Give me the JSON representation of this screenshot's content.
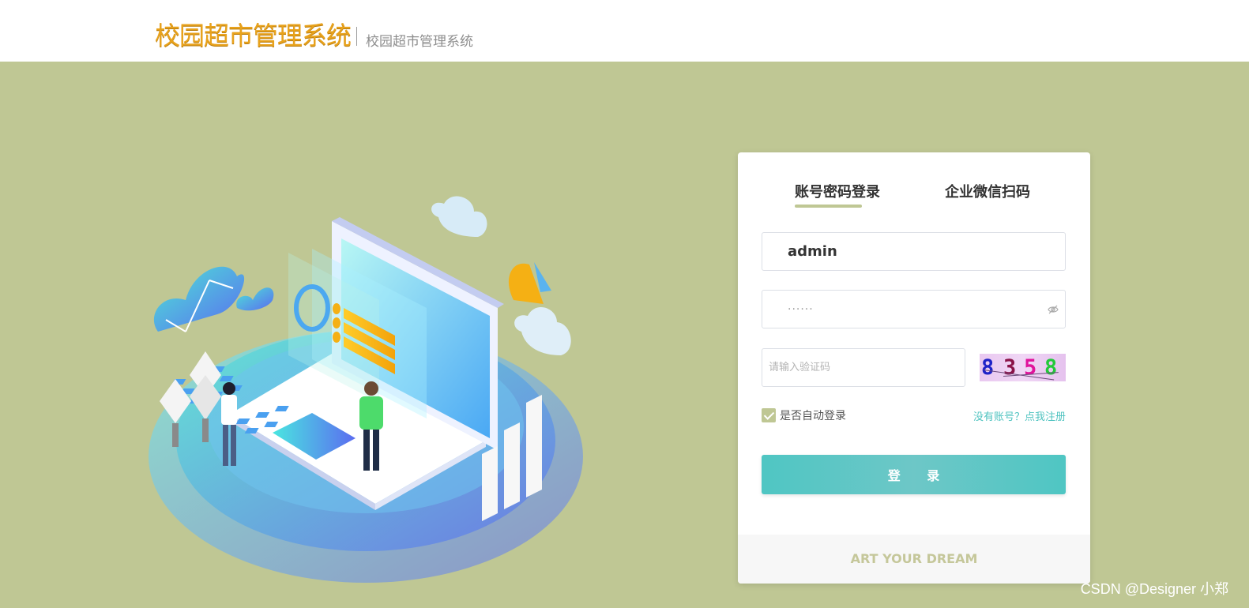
{
  "header": {
    "brand_title": "校园超市管理系统",
    "brand_subtitle": "校园超市管理系统"
  },
  "login": {
    "tabs": [
      {
        "label": "账号密码登录",
        "active": true
      },
      {
        "label": "企业微信扫码",
        "active": false
      }
    ],
    "username_value": "admin",
    "password_value": "······",
    "captcha_placeholder": "请输入验证码",
    "captcha_chars": [
      {
        "char": "8",
        "color": "#1f22c8"
      },
      {
        "char": "3",
        "color": "#8a1248"
      },
      {
        "char": "5",
        "color": "#e0139b"
      },
      {
        "char": "8",
        "color": "#22c93a"
      }
    ],
    "remember_label": "是否自动登录",
    "remember_checked": true,
    "register_link": "没有账号？点我注册",
    "login_button": "登 录",
    "footer_text": "ART YOUR DREAM"
  },
  "watermark": "CSDN @Designer 小郑",
  "colors": {
    "background": "#bfc794",
    "accent": "#bfc794",
    "button": "#56c6c3",
    "brand": "#e8a21c",
    "link": "#4fc3c0"
  }
}
